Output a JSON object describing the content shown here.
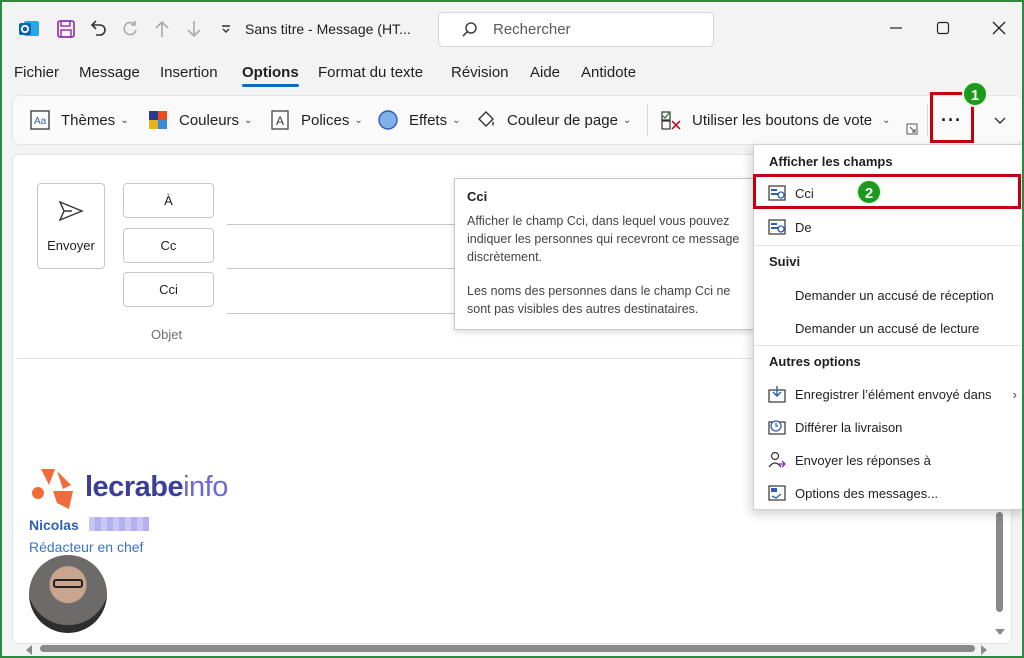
{
  "window": {
    "title": "Sans titre  -  Message (HT...",
    "search_placeholder": "Rechercher"
  },
  "tabs": [
    {
      "label": "Fichier"
    },
    {
      "label": "Message"
    },
    {
      "label": "Insertion"
    },
    {
      "label": "Options",
      "active": true
    },
    {
      "label": "Format du texte"
    },
    {
      "label": "Révision"
    },
    {
      "label": "Aide"
    },
    {
      "label": "Antidote"
    }
  ],
  "ribbon": {
    "themes": "Thèmes",
    "colors": "Couleurs",
    "fonts": "Polices",
    "effects": "Effets",
    "page_color": "Couleur de page",
    "vote_buttons": "Utiliser les boutons de vote",
    "more": "···"
  },
  "compose": {
    "send": "Envoyer",
    "to": "À",
    "cc": "Cc",
    "bcc": "Cci",
    "subject": "Objet"
  },
  "signature": {
    "logo_part1": "lecrabe",
    "logo_part2": "info",
    "name": "Nicolas",
    "role": "Rédacteur en chef"
  },
  "tooltip": {
    "title": "Cci",
    "p1": "Afficher le champ Cci, dans lequel vous pouvez indiquer les personnes qui recevront ce message discrètement.",
    "p2": "Les noms des personnes dans le champ Cci ne sont pas visibles des autres destinataires."
  },
  "dropdown": {
    "section1": "Afficher les champs",
    "item_cci": "Cci",
    "item_de": "De",
    "section2": "Suivi",
    "item_receipt_delivery": "Demander un accusé de réception",
    "item_receipt_read": "Demander un accusé de lecture",
    "section3": "Autres options",
    "item_save_sent": "Enregistrer l’élément envoyé dans",
    "item_delay": "Différer la livraison",
    "item_reply_to": "Envoyer les réponses à",
    "item_msg_options": "Options des messages..."
  },
  "annotations": {
    "badge1": "1",
    "badge2": "2"
  },
  "colors": {
    "accent": "#0f6cbd",
    "annotation_red": "#c30010",
    "badge_green": "#1b9a1b"
  }
}
